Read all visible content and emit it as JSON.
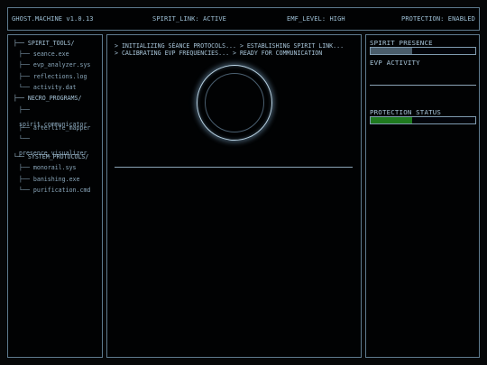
{
  "header": {
    "app_title": "GHOST.MACHINE v1.0.13",
    "spirit_link": "SPIRIT_LINK: ACTIVE",
    "emf_level": "EMF_LEVEL: HIGH",
    "protection": "PROTECTION: ENABLED"
  },
  "sidebar": {
    "items": [
      {
        "prefix": "├── ",
        "label": "SPIRIT_TOOLS/",
        "type": "folder"
      },
      {
        "prefix": "│   ├── ",
        "label": "seance.exe",
        "type": "file"
      },
      {
        "prefix": "│   ├── ",
        "label": "evp_analyzer.sys",
        "type": "file"
      },
      {
        "prefix": "│   ├── ",
        "label": "reflections.log",
        "type": "file"
      },
      {
        "prefix": "│   └── ",
        "label": "activity.dat",
        "type": "file"
      },
      {
        "prefix": "├── ",
        "label": "NECRO_PROGRAMS/",
        "type": "folder"
      },
      {
        "prefix": "│   ├── ",
        "label": "spirit_communicator",
        "type": "file",
        "wrapped": true
      },
      {
        "prefix": "│   ├── ",
        "label": "afterlife_mapper",
        "type": "file"
      },
      {
        "prefix": "│   └── ",
        "label": "presence_visualizer",
        "type": "file",
        "wrapped": true
      },
      {
        "prefix": "└── ",
        "label": "SYSTEM_PROTOCOLS/",
        "type": "folder"
      },
      {
        "prefix": "    ├── ",
        "label": "monorail.sys",
        "type": "file"
      },
      {
        "prefix": "    ├── ",
        "label": "banishing.exe",
        "type": "file"
      },
      {
        "prefix": "    └── ",
        "label": "purification.cmd",
        "type": "file"
      }
    ]
  },
  "console": {
    "lines": [
      "> INITIALIZING SÉANCE PROTOCOLS... > ESTABLISHING SPIRIT LINK...",
      "> CALIBRATING EVP FREQUENCIES... > READY FOR COMMUNICATION"
    ]
  },
  "status": {
    "spirit_presence": {
      "label": "SPIRIT PRESENCE",
      "level": 0.4,
      "color": "#4a5d6b"
    },
    "evp_activity": {
      "label": "EVP ACTIVITY"
    },
    "protection_status": {
      "label": "PROTECTION STATUS",
      "level": 0.4,
      "color": "#1f7a1f"
    }
  }
}
